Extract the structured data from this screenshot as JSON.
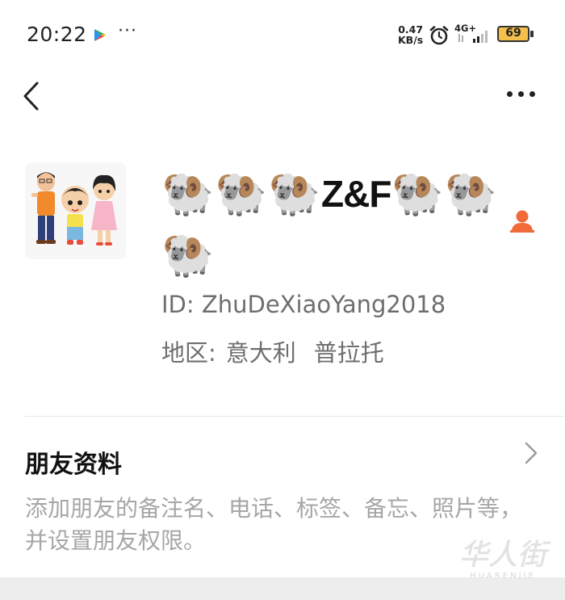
{
  "status_bar": {
    "time": "20:22",
    "more": "···",
    "net_speed_value": "0.47",
    "net_speed_unit": "KB/s",
    "network_type": "4G+",
    "battery_level": "69",
    "icons": [
      "play-store-icon",
      "alarm-icon",
      "signal-icon",
      "battery-icon"
    ]
  },
  "nav": {
    "back_icon": "chevron-left-icon",
    "menu_icon": "more-dots-icon"
  },
  "profile": {
    "nickname_prefix": [
      "🐏",
      "🐏",
      "🐏"
    ],
    "nickname_text": "Z&F",
    "nickname_suffix": [
      "🐏",
      "🐏",
      "🐏"
    ],
    "id_label": "ID:",
    "id_value": "ZhuDeXiaoYang2018",
    "region_label": "地区:",
    "region_country": "意大利",
    "region_city": "普拉托",
    "accent_color": "#f06a3a"
  },
  "friend_info": {
    "title": "朋友资料",
    "description": "添加朋友的备注名、电话、标签、备忘、照片等，并设置朋友权限。"
  },
  "watermark": {
    "main": "华人街",
    "sub": "HUARENJIE"
  }
}
